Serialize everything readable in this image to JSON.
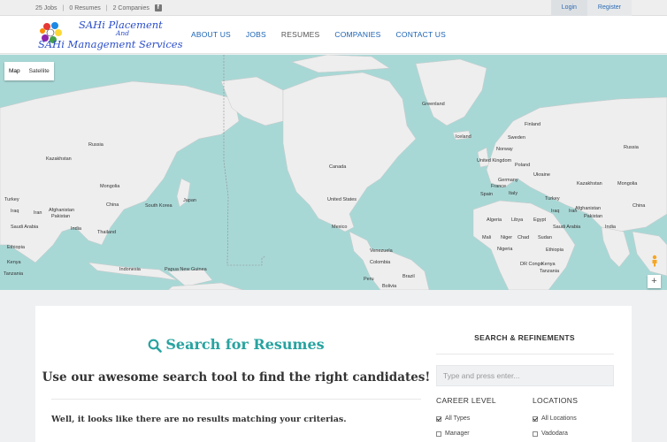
{
  "topbar": {
    "jobs": "25 Jobs",
    "resumes": "0 Resumes",
    "companies": "2 Companies",
    "sep": "|",
    "facebook_icon": "facebook-icon",
    "login": "Login",
    "register": "Register"
  },
  "logo": {
    "line1_initials": "SAHi",
    "line1_rest": "Placement",
    "line2": "And",
    "line3_initials": "SAHi",
    "line3_rest": "Management Services"
  },
  "nav": {
    "items": [
      "ABOUT US",
      "JOBS",
      "RESUMES",
      "COMPANIES",
      "CONTACT US"
    ],
    "active": "RESUMES"
  },
  "map": {
    "type_buttons": [
      "Map",
      "Satellite"
    ],
    "selected_type": "Map",
    "zoom_in": "+",
    "labels": [
      "Greenland",
      "Iceland",
      "Finland",
      "Sweden",
      "Norway",
      "Russia",
      "Russia",
      "Kazakhstan",
      "Mongolia",
      "China",
      "South Korea",
      "Japan",
      "Turkey",
      "Iran",
      "Iraq",
      "Afghanistan",
      "Pakistan",
      "India",
      "Saudi Arabia",
      "Thailand",
      "Ethiopia",
      "Kenya",
      "Tanzania",
      "Indonesia",
      "Papua New Guinea",
      "Canada",
      "United States",
      "Mexico",
      "Venezuela",
      "Colombia",
      "Peru",
      "Brazil",
      "Bolivia",
      "United Kingdom",
      "Poland",
      "Germany",
      "Ukraine",
      "France",
      "Spain",
      "Italy",
      "Kazakhstan",
      "Mongolia",
      "China",
      "Afghanistan",
      "Pakistan",
      "India",
      "Algeria",
      "Libya",
      "Egypt",
      "Mali",
      "Niger",
      "Chad",
      "Sudan",
      "Nigeria",
      "DR Congo",
      "Ethiopia",
      "Kenya",
      "Tanzania",
      "Turkey",
      "Iraq",
      "Iran",
      "Saudi Arabia"
    ],
    "colors": {
      "ocean": "#a8d8d6",
      "land": "#eeeeee"
    }
  },
  "main": {
    "title": "Search for Resumes",
    "subtitle": "Use our awesome search tool to find the right candidates!",
    "no_results": "Well, it looks like there are no results matching your criterias."
  },
  "sidebar": {
    "title": "SEARCH & REFINEMENTS",
    "search_placeholder": "Type and press enter...",
    "career_level": {
      "heading": "CAREER LEVEL",
      "options": [
        {
          "label": "All Types",
          "checked": true
        },
        {
          "label": "Manager",
          "checked": false
        }
      ]
    },
    "locations": {
      "heading": "LOCATIONS",
      "options": [
        {
          "label": "All Locations",
          "checked": true
        },
        {
          "label": "Vadodara",
          "checked": false
        }
      ]
    }
  },
  "colors": {
    "accent": "#27a3a0",
    "link": "#1a63b4"
  }
}
